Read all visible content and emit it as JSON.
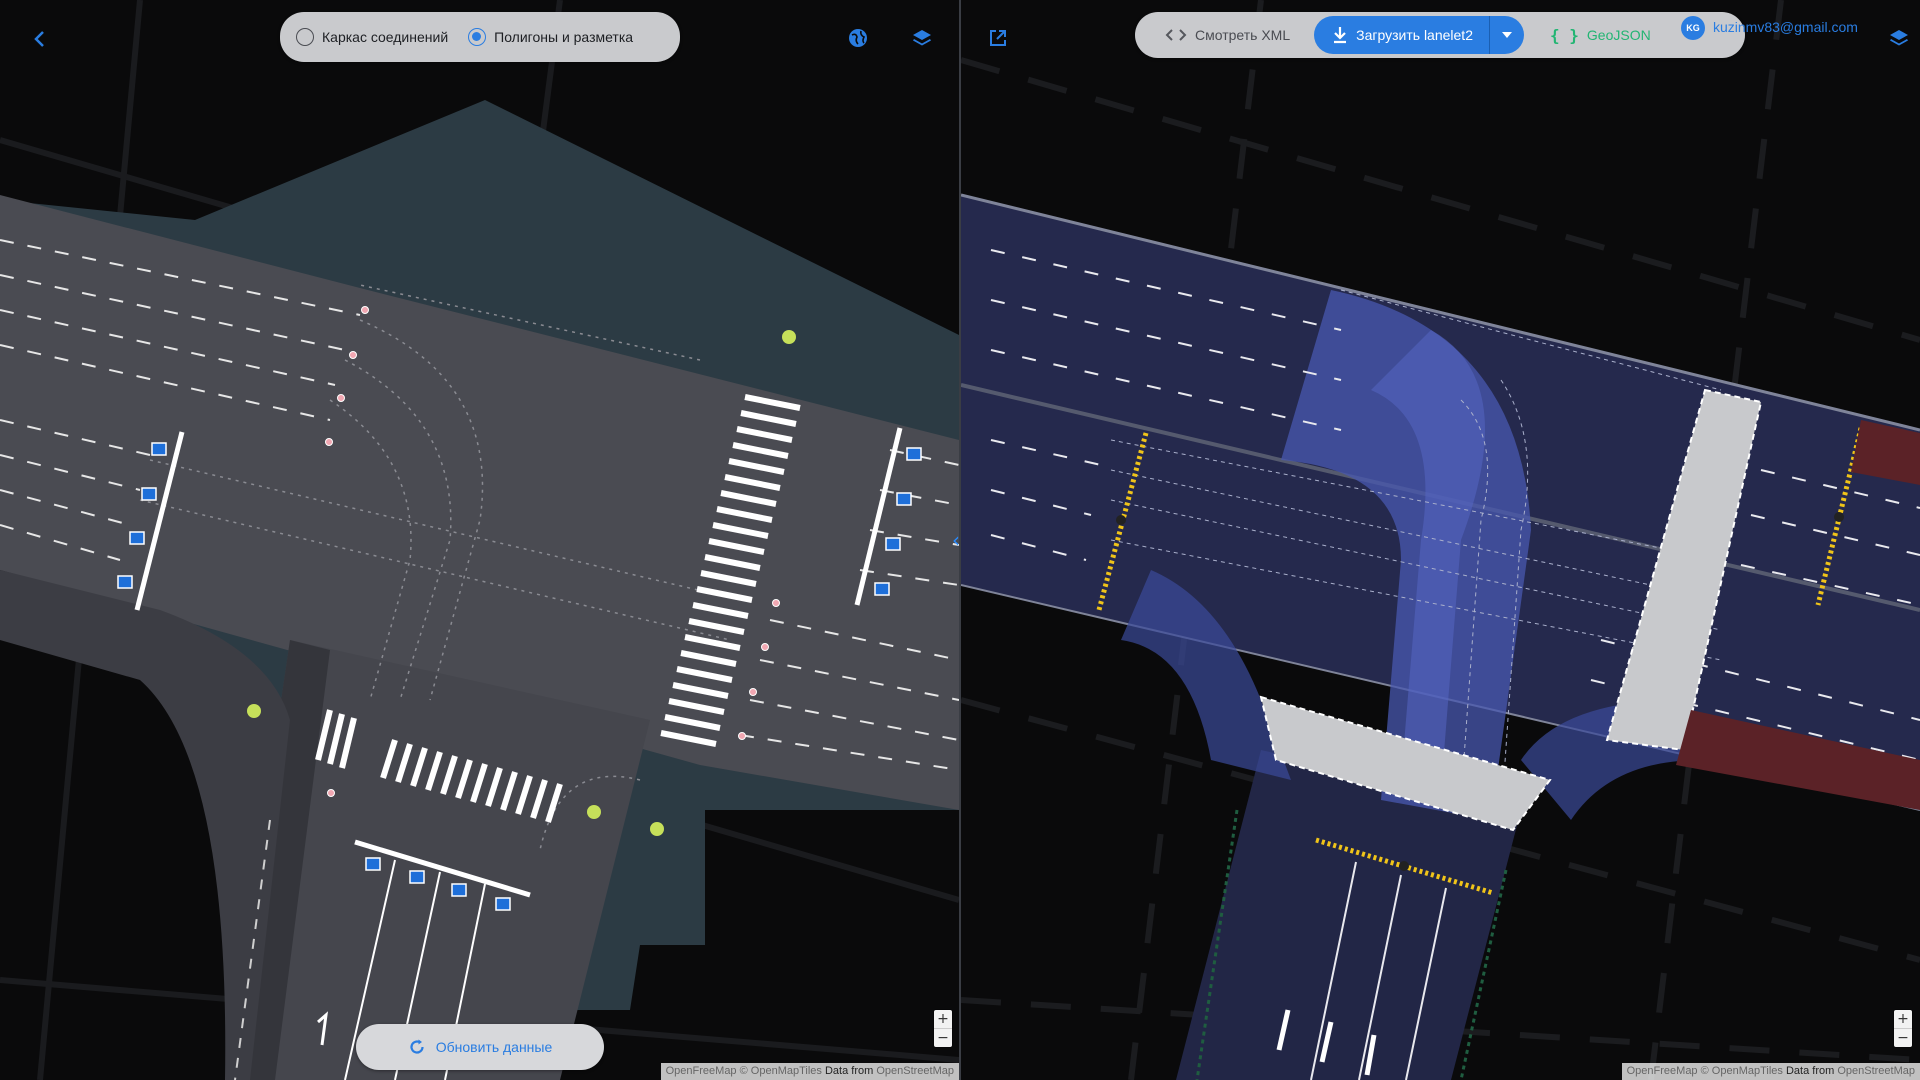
{
  "left_pane": {
    "view_toggle": {
      "options": [
        {
          "label": "Каркас соединений",
          "selected": false
        },
        {
          "label": "Полигоны и разметка",
          "selected": true
        }
      ]
    },
    "refresh_button_label": "Обновить данные",
    "attribution": {
      "a": "OpenFreeMap",
      "b": "© OpenMapTiles",
      "c": "Data from",
      "d": "OpenStreetMap"
    },
    "icons": {
      "back": "chevron-left-icon",
      "globe": "globe-icon",
      "layers": "layers-icon",
      "refresh": "refresh-icon"
    }
  },
  "right_pane": {
    "toolbar": {
      "view_xml_label": "Смотреть XML",
      "download_label": "Загрузить lanelet2",
      "geojson_label": "GeoJSON"
    },
    "user": {
      "initials": "KG",
      "email": "kuzinmv83@gmail.com"
    },
    "attribution": {
      "a": "OpenFreeMap",
      "b": "© OpenMapTiles",
      "c": "Data from",
      "d": "OpenStreetMap"
    },
    "icons": {
      "external": "external-link-icon",
      "code": "code-icon",
      "download": "download-icon",
      "braces": "braces-icon",
      "layers": "layers-icon"
    }
  },
  "zoom": {
    "in": "+",
    "out": "−"
  },
  "splitter_glyph": "‹›",
  "colors": {
    "accent": "#2a7de1",
    "road": "#4a4b52",
    "lanelet": "#25294d",
    "crosswalk": "#c8c9cc",
    "area": "#2c3b44"
  }
}
